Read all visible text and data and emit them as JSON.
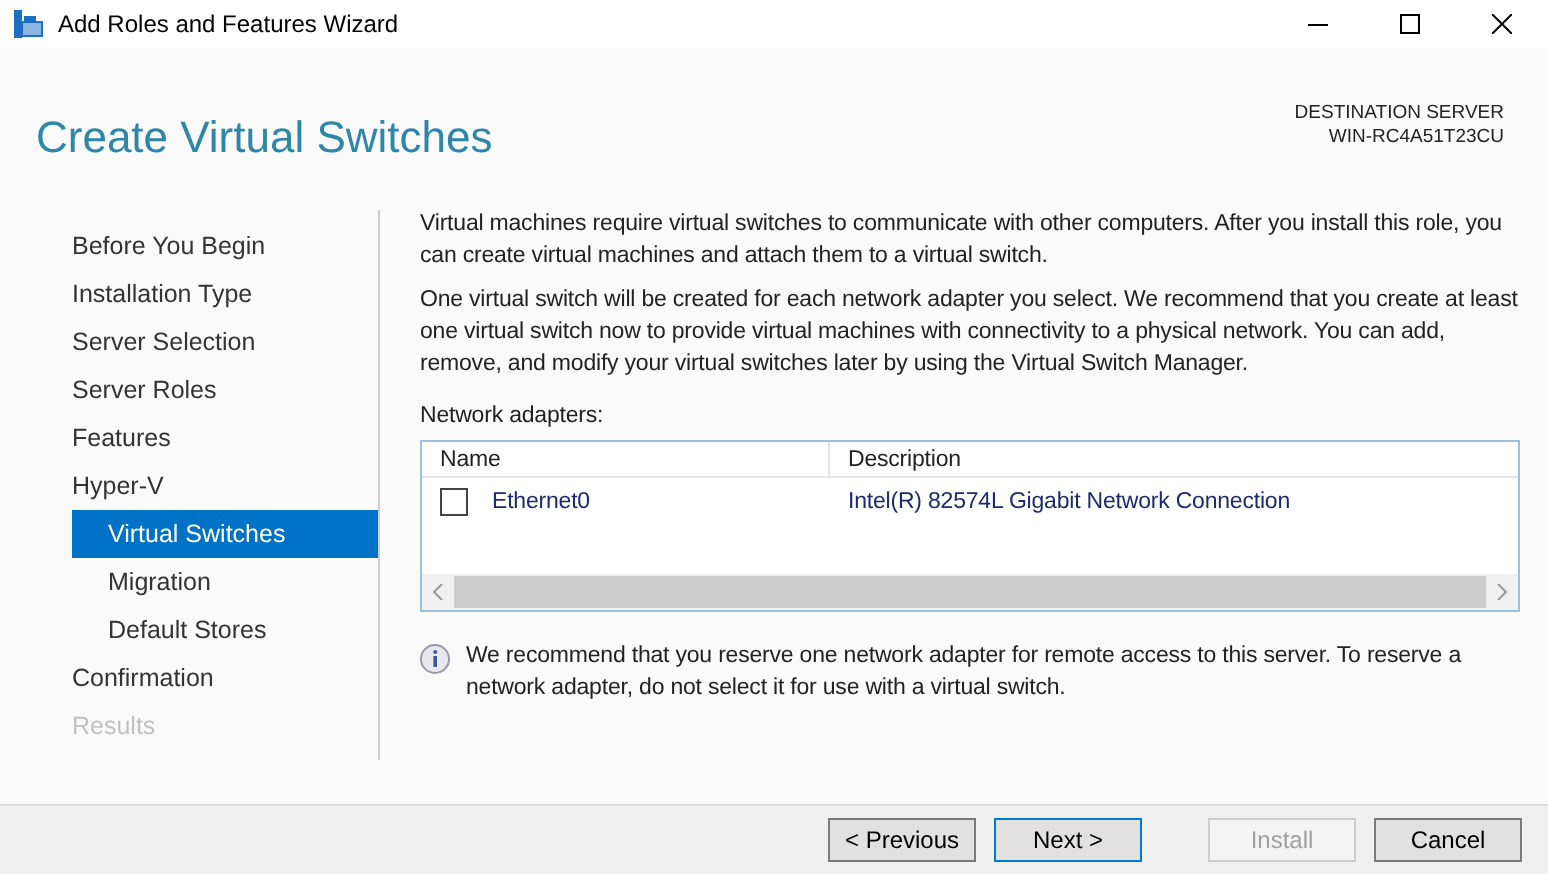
{
  "window": {
    "title": "Add Roles and Features Wizard"
  },
  "header": {
    "title": "Create Virtual Switches",
    "destination_label": "DESTINATION SERVER",
    "destination_server": "WIN-RC4A51T23CU"
  },
  "sidebar": {
    "items": [
      {
        "label": "Before You Begin",
        "selected": false,
        "disabled": false
      },
      {
        "label": "Installation Type",
        "selected": false,
        "disabled": false
      },
      {
        "label": "Server Selection",
        "selected": false,
        "disabled": false
      },
      {
        "label": "Server Roles",
        "selected": false,
        "disabled": false
      },
      {
        "label": "Features",
        "selected": false,
        "disabled": false
      },
      {
        "label": "Hyper-V",
        "selected": false,
        "disabled": false,
        "children": [
          {
            "label": "Virtual Switches",
            "selected": true,
            "disabled": false
          },
          {
            "label": "Migration",
            "selected": false,
            "disabled": false
          },
          {
            "label": "Default Stores",
            "selected": false,
            "disabled": false
          }
        ]
      },
      {
        "label": "Confirmation",
        "selected": false,
        "disabled": false
      },
      {
        "label": "Results",
        "selected": false,
        "disabled": true
      }
    ]
  },
  "content": {
    "paragraphs": [
      "Virtual machines require virtual switches to communicate with other computers. After you install this role, you can create virtual machines and attach them to a virtual switch.",
      "One virtual switch will be created for each network adapter you select. We recommend that you create at least one virtual switch now to provide virtual machines with connectivity to a physical network. You can add, remove, and modify your virtual switches later by using the Virtual Switch Manager."
    ],
    "adapters_label": "Network adapters:",
    "table": {
      "columns": [
        "Name",
        "Description"
      ],
      "rows": [
        {
          "name": "Ethernet0",
          "description": "Intel(R) 82574L Gigabit Network Connection",
          "checked": false
        }
      ]
    },
    "note": "We recommend that you reserve one network adapter for remote access to this server. To reserve a network adapter, do not select it for use with a virtual switch."
  },
  "buttons": [
    {
      "label": "< Previous",
      "disabled": false,
      "focused": false
    },
    {
      "label": "Next >",
      "disabled": false,
      "focused": true
    },
    {
      "label": "Install",
      "disabled": true,
      "focused": false
    },
    {
      "label": "Cancel",
      "disabled": false,
      "focused": false
    }
  ]
}
